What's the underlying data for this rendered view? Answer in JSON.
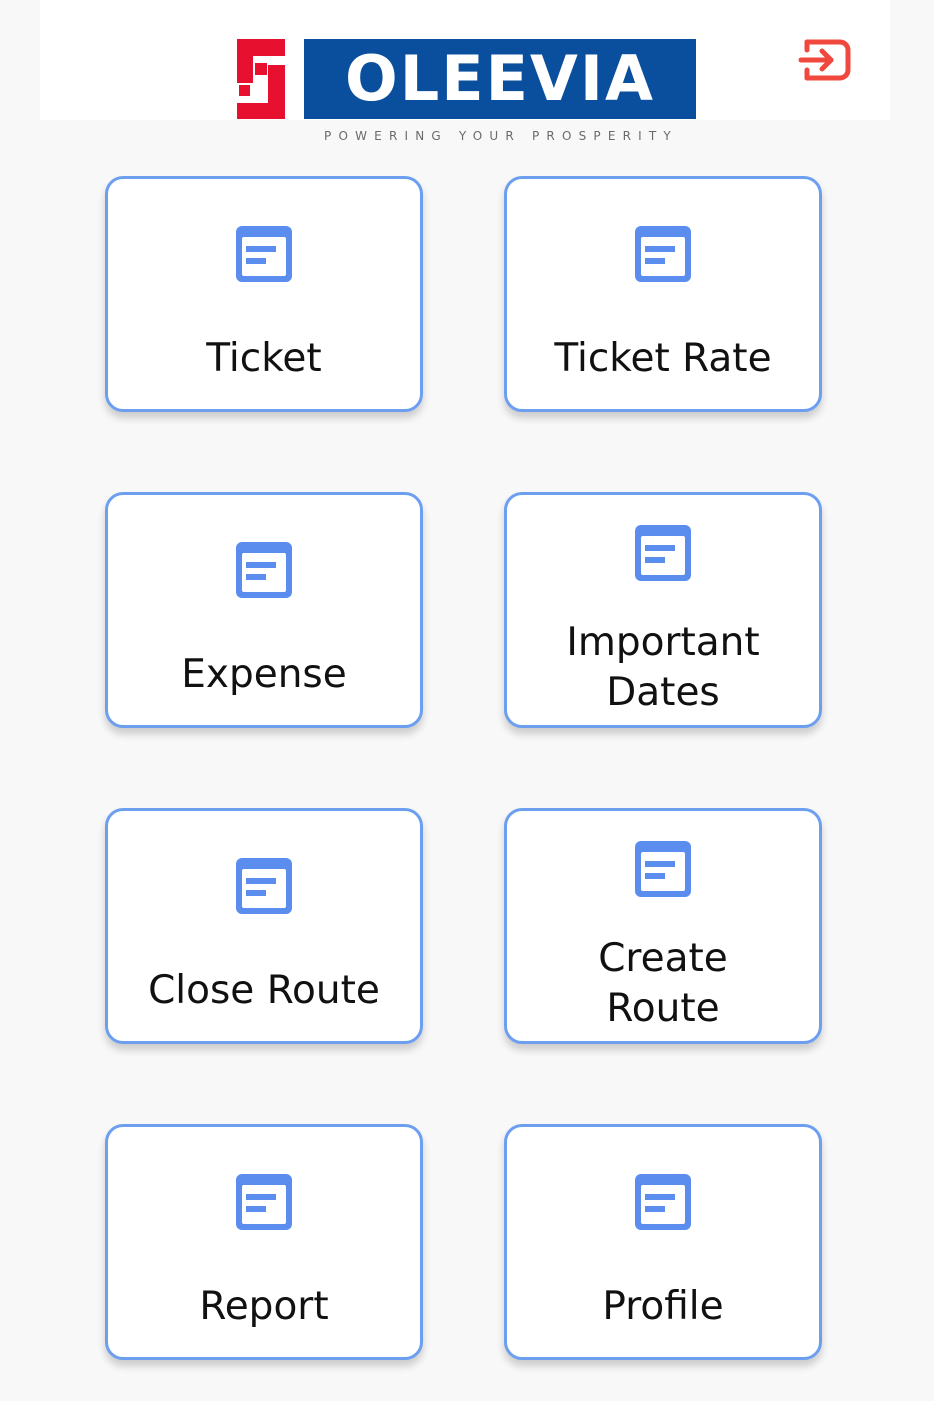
{
  "header": {
    "brand_name": "OLEEVIA",
    "tagline": "POWERING YOUR PROSPERITY",
    "logout_icon": "logout-icon"
  },
  "colors": {
    "background": "#f8f8f8",
    "card_border": "#6d9ff0",
    "icon_blue": "#5b8def",
    "brand_blue": "#0a4f9e",
    "brand_red": "#e8102f",
    "logout_red": "#f0483e"
  },
  "menu": [
    {
      "label": "Ticket",
      "icon": "document-icon"
    },
    {
      "label": "Ticket Rate",
      "icon": "document-icon"
    },
    {
      "label": "Expense",
      "icon": "document-icon"
    },
    {
      "label": "Important Dates",
      "icon": "document-icon"
    },
    {
      "label": "Close Route",
      "icon": "document-icon"
    },
    {
      "label": "Create Route",
      "icon": "document-icon"
    },
    {
      "label": "Report",
      "icon": "document-icon"
    },
    {
      "label": "Profile",
      "icon": "document-icon"
    }
  ]
}
